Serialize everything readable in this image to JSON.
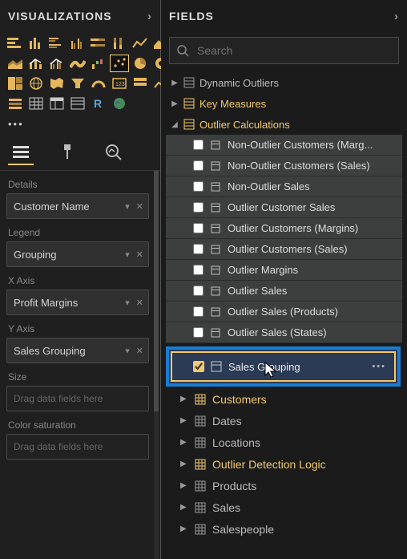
{
  "left": {
    "title": "VISUALIZATIONS",
    "viz_ellipsis": "•••",
    "wells": {
      "details_label": "Details",
      "details_value": "Customer Name",
      "legend_label": "Legend",
      "legend_value": "Grouping",
      "xaxis_label": "X Axis",
      "xaxis_value": "Profit Margins",
      "yaxis_label": "Y Axis",
      "yaxis_value": "Sales Grouping",
      "size_label": "Size",
      "size_placeholder": "Drag data fields here",
      "color_label": "Color saturation",
      "color_placeholder": "Drag data fields here"
    }
  },
  "right": {
    "title": "FIELDS",
    "search_placeholder": "Search",
    "tables_top": [
      {
        "label": "Dynamic Outliers",
        "highlight": false
      },
      {
        "label": "Key Measures",
        "highlight": true
      },
      {
        "label": "Outlier Calculations",
        "highlight": true,
        "expanded": true
      }
    ],
    "fields": [
      "Non-Outlier Customers (Marg...",
      "Non-Outlier Customers (Sales)",
      "Non-Outlier Sales",
      "Outlier Customer Sales",
      "Outlier Customers (Margins)",
      "Outlier Customers (Sales)",
      "Outlier Margins",
      "Outlier Sales",
      "Outlier Sales (Products)",
      "Outlier Sales (States)"
    ],
    "drag_field": "Sales Grouping",
    "tables_bottom": [
      {
        "label": "Customers",
        "highlight": true
      },
      {
        "label": "Dates",
        "highlight": false
      },
      {
        "label": "Locations",
        "highlight": false
      },
      {
        "label": "Outlier Detection Logic",
        "highlight": true
      },
      {
        "label": "Products",
        "highlight": false
      },
      {
        "label": "Sales",
        "highlight": false
      },
      {
        "label": "Salespeople",
        "highlight": false
      }
    ]
  }
}
